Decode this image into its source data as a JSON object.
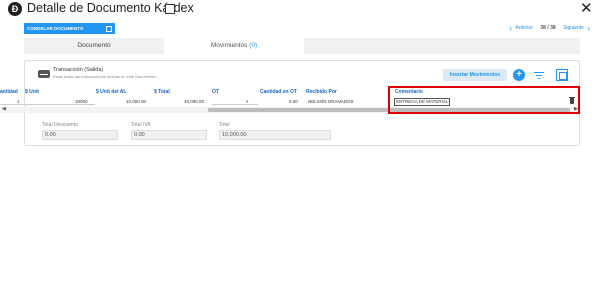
{
  "window": {
    "logo_glyph": "Ð",
    "title": "Detalle de Documento Kárdex",
    "close_glyph": "✕"
  },
  "toolbar": {
    "freeze_label": "CONGELAR DOCUMENTO"
  },
  "pager": {
    "prev_label": "Anterior",
    "count": "38 / 38",
    "next_label": "Siguiente"
  },
  "tabs": [
    {
      "label": "Documento"
    },
    {
      "label": "Movimientos",
      "count": "(0)"
    }
  ],
  "section": {
    "title": "Transacción (Salida)",
    "subtitle": "Estas todas las transacciones hechas en este Documento",
    "insert_button": "Insertar Movimientos",
    "add_glyph": "+"
  },
  "table": {
    "headers": {
      "cantidad": "antidad",
      "unit": "$ Unit",
      "unit_al": "$ Unit del AL",
      "total": "$ Total",
      "ot": "OT",
      "cantidad_ot": "Cantidad en OT",
      "recibido": "Recibido Por",
      "comentario": "Comentario"
    },
    "row": {
      "cantidad": "1",
      "unit": "10000",
      "unit_al": "10,000.00",
      "total": "10,000.00",
      "ot_arrow": "▼",
      "cantidad_ot": "0.00",
      "recibido": "NELSON GRANADOS",
      "comentario": "ENTREGA DE MATERIAL"
    }
  },
  "totals": {
    "descuento_label": "Total Descuento",
    "descuento_value": "0.00",
    "iva_label": "Total IVA",
    "iva_value": "0.00",
    "total_label": "Total",
    "total_value": "10,000.00"
  },
  "colors": {
    "accent": "#2196f3",
    "header_text": "#1565c0",
    "highlight": "#e00000"
  }
}
